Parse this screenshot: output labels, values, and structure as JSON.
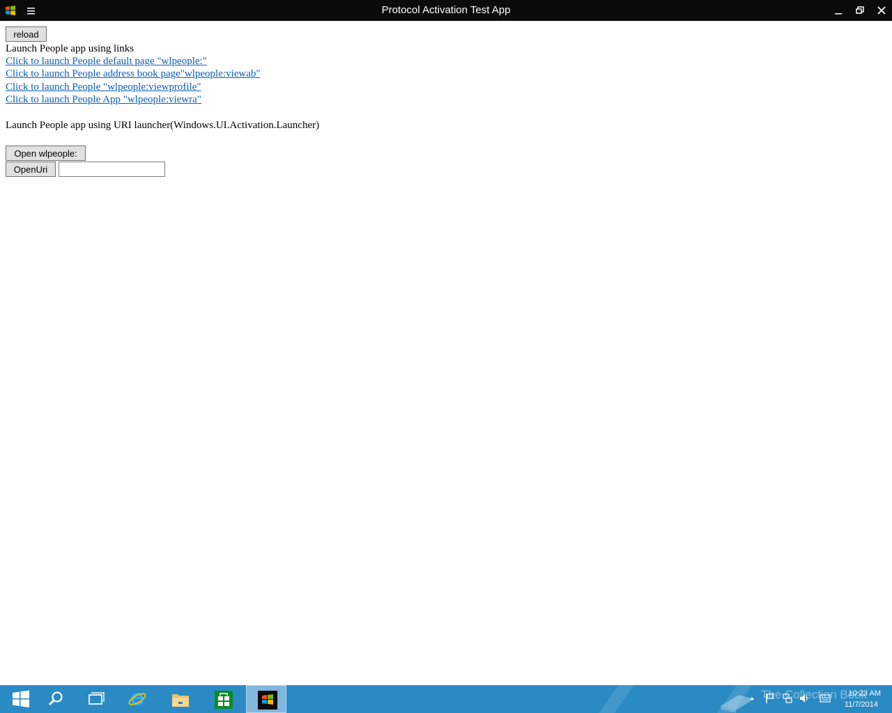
{
  "window": {
    "title": "Protocol Activation Test App"
  },
  "toolbar": {
    "reload_label": "reload"
  },
  "links_section": {
    "heading": "Launch People app using links",
    "links": [
      "Click to launch People default page \"wlpeople:\"",
      "Click to launch People address book page\"wlpeople:viewab\"",
      "Click to launch People \"wlpeople:viewprofile\"",
      "Click to launch People App \"wlpeople:viewra\""
    ]
  },
  "launcher_section": {
    "heading": "Launch People app using URI launcher(Windows.UI.Activation.Launcher)",
    "open_wlpeople_label": "Open wlpeople:",
    "open_uri_label": "OpenUri",
    "uri_input_value": "",
    "uri_input_placeholder": ""
  },
  "taskbar": {
    "pinned": [
      "start-icon",
      "search-icon",
      "task-view-icon",
      "internet-explorer-icon",
      "file-explorer-icon",
      "store-icon",
      "protocol-app-icon"
    ],
    "clock_time": "10:23 AM",
    "clock_date": "11/7/2014",
    "watermark": "The Collection Book"
  },
  "colors": {
    "titlebar": "#0b0b0b",
    "link": "#0a5db5",
    "taskbar": "#2a8ac4"
  }
}
